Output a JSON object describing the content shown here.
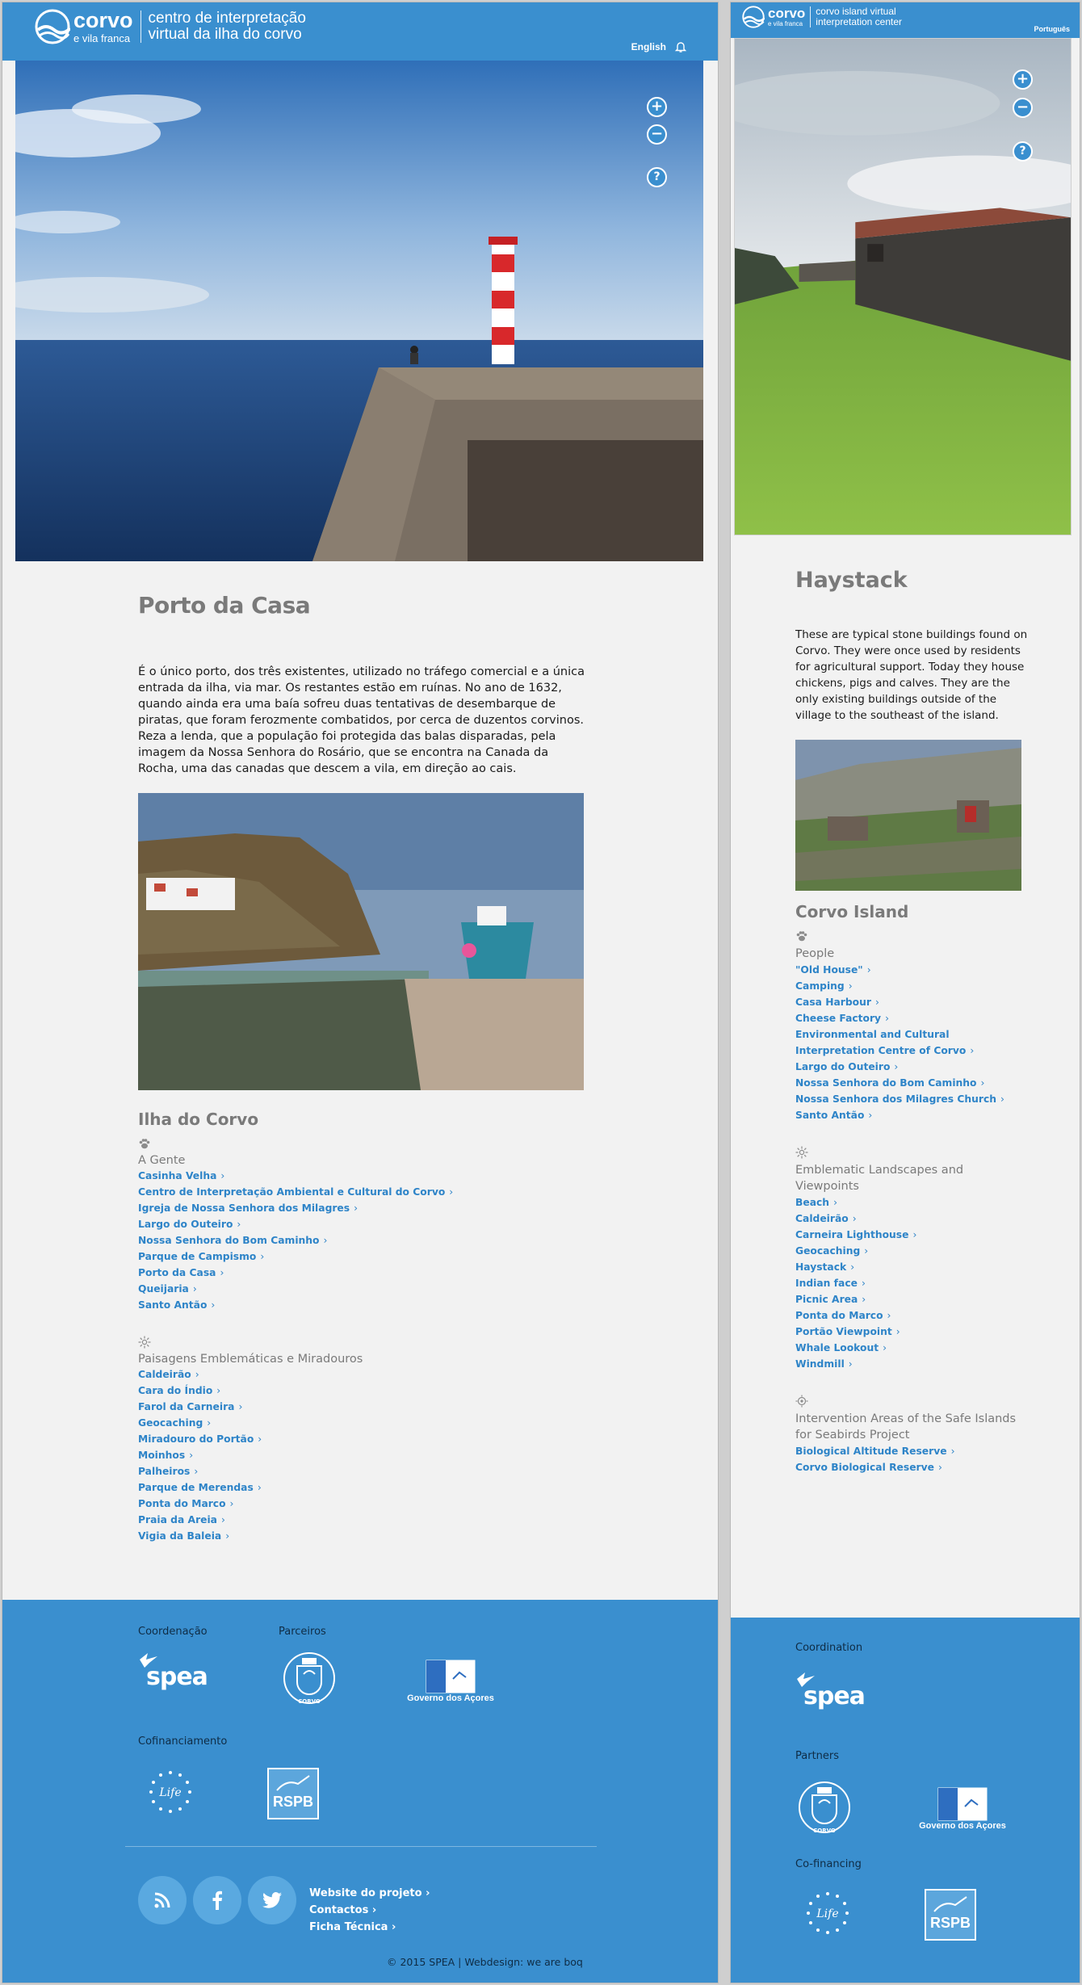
{
  "brand": {
    "logo_main": "corvo",
    "logo_sub": "e vila franca",
    "color_primary": "#3a8fcf",
    "color_link": "#2e84c8"
  },
  "left": {
    "header": {
      "title_line1": "centro de interpretação",
      "title_line2": "virtual da ilha do corvo",
      "language_link": "English"
    },
    "viewer": {
      "zoom_in": "+",
      "zoom_out": "−",
      "help": "?"
    },
    "place": {
      "title": "Porto da Casa",
      "description": "É o único porto, dos três existentes, utilizado no tráfego comercial e a única entrada da ilha, via mar. Os restantes estão em ruínas. No ano de 1632, quando ainda era uma baía sofreu duas tentativas de desembarque de piratas, que foram ferozmente combatidos, por cerca de duzentos corvinos. Reza a lenda, que a população foi protegida das balas disparadas, pela imagem da Nossa Senhora do Rosário, que se encontra na Canada da Rocha, uma das canadas que descem a vila, em direção ao cais."
    },
    "island": {
      "title": "Ilha do Corvo",
      "categories": [
        {
          "icon": "paw-icon",
          "heading": "A Gente",
          "links": [
            "Casinha Velha",
            "Centro de Interpretação Ambiental e Cultural do Corvo",
            "Igreja de Nossa Senhora dos Milagres",
            "Largo do Outeiro",
            "Nossa Senhora do Bom Caminho",
            "Parque de Campismo",
            "Porto da Casa",
            "Queijaria",
            "Santo Antão"
          ]
        },
        {
          "icon": "sun-icon",
          "heading": "Paisagens Emblemáticas e Miradouros",
          "links": [
            "Caldeirão",
            "Cara do Índio",
            "Farol da Carneira",
            "Geocaching",
            "Miradouro do Portão",
            "Moinhos",
            "Palheiros",
            "Parque de Merendas",
            "Ponta do Marco",
            "Praia da Areia",
            "Vigia da Baleia"
          ]
        }
      ]
    },
    "footer": {
      "coordination_label": "Coordenação",
      "partners_label": "Parceiros",
      "cofinancing_label": "Cofinanciamento",
      "spea_logo": "spea",
      "corvo_seal_text": "CORVO",
      "gov_logo": "Governo dos Açores",
      "life_logo": "Life",
      "rspb_logo": "RSPB",
      "links": [
        "Website do projeto",
        "Contactos",
        "Ficha Técnica"
      ],
      "copyright": "© 2015 SPEA | Webdesign: we are boq",
      "social": [
        "rss-icon",
        "facebook-icon",
        "twitter-icon"
      ]
    }
  },
  "right": {
    "header": {
      "title_line1": "corvo island virtual",
      "title_line2": "interpretation center",
      "language_link": "Português"
    },
    "viewer": {
      "zoom_in": "+",
      "zoom_out": "−",
      "help": "?"
    },
    "place": {
      "title": "Haystack",
      "description": "These are typical stone buildings found on Corvo. They were once used by residents for agricultural support. Today they house chickens, pigs and calves. They are the only existing buildings outside of the village to the southeast of the island."
    },
    "island": {
      "title": "Corvo Island",
      "categories": [
        {
          "icon": "paw-icon",
          "heading": "People",
          "links": [
            "\"Old House\"",
            "Camping",
            "Casa Harbour",
            "Cheese Factory",
            "Environmental and Cultural Interpretation Centre of Corvo",
            "Largo do Outeiro",
            "Nossa Senhora do Bom Caminho",
            "Nossa Senhora dos Milagres Church",
            "Santo Antão"
          ]
        },
        {
          "icon": "sun-icon",
          "heading": "Emblematic Landscapes and Viewpoints",
          "links": [
            "Beach",
            "Caldeirão",
            "Carneira Lighthouse",
            "Geocaching",
            "Haystack",
            "Indian face",
            "Picnic Area",
            "Ponta do Marco",
            "Portão Viewpoint",
            "Whale Lookout",
            "Windmill"
          ]
        },
        {
          "icon": "dot-sun-icon",
          "heading": "Intervention Areas of the Safe Islands for Seabirds Project",
          "links": [
            "Biological Altitude Reserve",
            "Corvo Biological Reserve"
          ]
        }
      ]
    },
    "footer": {
      "coordination_label": "Coordination",
      "partners_label": "Partners",
      "cofinancing_label": "Co-financing",
      "spea_logo": "spea",
      "corvo_seal_text": "CORVO",
      "gov_logo": "Governo dos Açores",
      "life_logo": "Life",
      "rspb_logo": "RSPB"
    }
  }
}
